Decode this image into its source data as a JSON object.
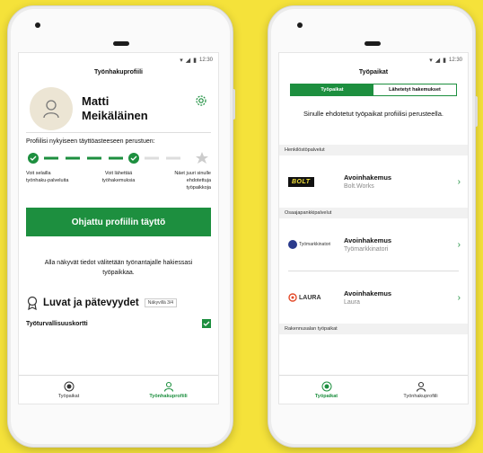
{
  "status": {
    "time": "12:30"
  },
  "profile_screen": {
    "title": "Työnhakuprofiili",
    "first_name": "Matti",
    "last_name": "Meikäläinen",
    "completion_text": "Profiilisi nykyiseen täyttöasteeseen perustuen:",
    "steps": [
      "Voit selailla työnhaku-palveluita",
      "Voit lähettää työhakemuksia",
      "Näet juuri sinulle ehdotettuja työpaikkoja"
    ],
    "cta_label": "Ohjattu profiilin täyttö",
    "info_text": "Alla näkyvät tiedot välitetään työnantajalle hakiessasi työpaikkaa.",
    "section_title": "Luvat ja pätevyydet",
    "section_count": "Näkyvillä 3/4",
    "cert_name": "Työturvallisuuskortti"
  },
  "jobs_screen": {
    "title": "Työpaikat",
    "tabs": [
      "Työpaikat",
      "Lähetetyt hakemukset"
    ],
    "intro": "Sinulle ehdotetut työpaikat profiilisi perusteella.",
    "categories": [
      "Henkilöstöpalvelut",
      "Osaajapankkipalvelut",
      "Rakennusalan työpaikat"
    ],
    "jobs": [
      {
        "title": "Avoinhakemus",
        "company": "Bolt.Works",
        "logo": "BOLT"
      },
      {
        "title": "Avoinhakemus",
        "company": "Työmarkkinatori",
        "logo": "Työmarkkinatori"
      },
      {
        "title": "Avoinhakemus",
        "company": "Laura",
        "logo": "LAURA"
      }
    ]
  },
  "nav": {
    "jobs": "Työpaikat",
    "profile": "Työnhakuprofiili"
  },
  "colors": {
    "accent": "#1d8f3f",
    "background": "#f5e23a"
  }
}
